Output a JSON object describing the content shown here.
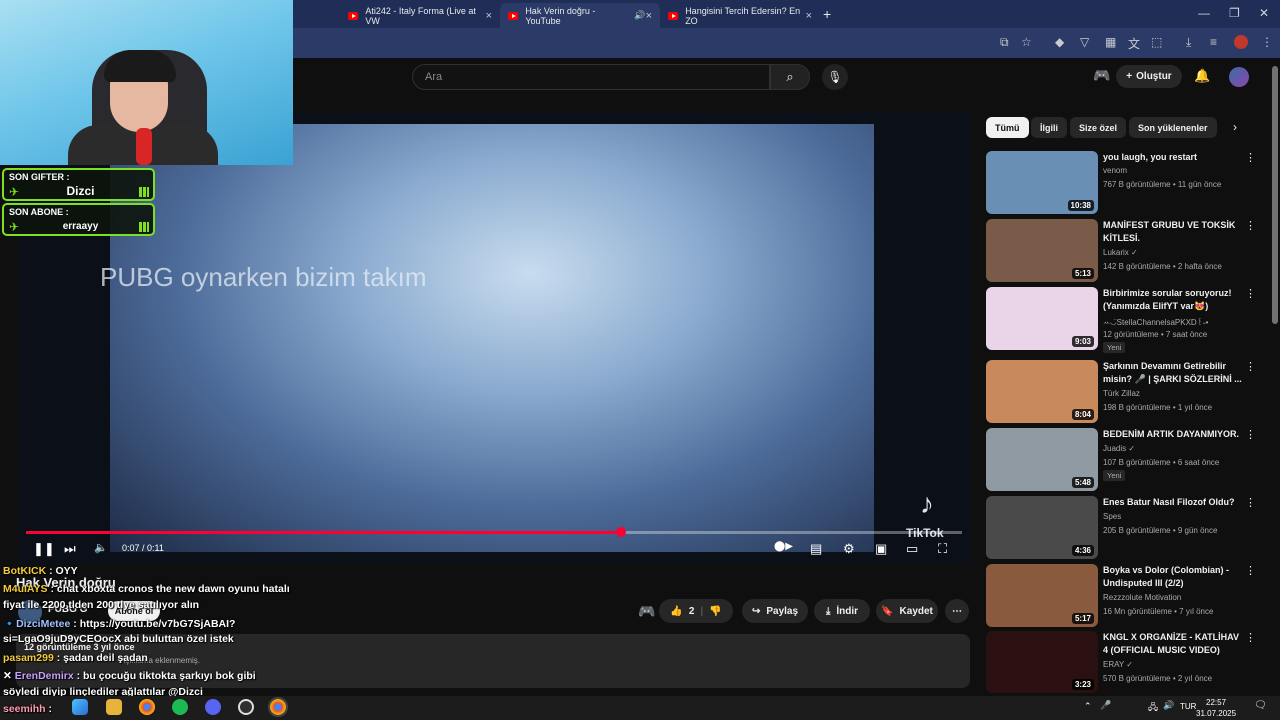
{
  "browser": {
    "tabs": [
      {
        "label": "Ati242 - Italy Forma (Live at VW",
        "active": false
      },
      {
        "label": "Hak Verin doğru - YouTube",
        "active": true
      },
      {
        "label": "Hangisini Tercih Edersin? En ZO",
        "active": false
      }
    ],
    "new_tab": "+",
    "close": "×"
  },
  "stream": {
    "gifter_label": "SON GIFTER :",
    "gifter_name": "Dizci",
    "sub_label": "SON ABONE :",
    "sub_name": "erraayy"
  },
  "youtube": {
    "search_placeholder": "Ara",
    "create_label": "Oluştur",
    "video_overlay_text": "PUBG oynarken bizim takım",
    "watermark": "TikTok",
    "progress": 0.636,
    "time": "0:07 / 0:11",
    "video_title": "Hak Verin doğru",
    "channel": "PUBG G",
    "subscribe": "Abone ol",
    "like_count": "2",
    "share": "Paylaş",
    "download": "İndir",
    "save": "Kaydet",
    "desc_views": "12 görüntüleme  3 yıl önce",
    "desc_more": "Açıklama eklenmemiş."
  },
  "chat": [
    {
      "user": "BotKICK",
      "text": ": OYY"
    },
    {
      "user": "M4uIAYS",
      "text": ": chat xboxta cronos the new dawn oyunu hatalı"
    },
    {
      "user": "",
      "text": "fiyat ile 2200 tlden 200 tlye satılıyor alın"
    },
    {
      "user": "DizciMetee",
      "text": ": https://youtu.be/v7bG7SjABAI?"
    },
    {
      "user": "",
      "text": "si=LgaO9juD9yCEOocX abi buluttan özel istek"
    },
    {
      "user": "pasam299",
      "text": ": şadan deil şadan"
    },
    {
      "user": "ErenDemirx",
      "text": ": bu çocuğu tiktokta şarkıyı bok gibi"
    },
    {
      "user": "",
      "text": "söyledi diyip linçlediler ağlattılar @Dizci"
    },
    {
      "user": "seemihh",
      "text": ":"
    }
  ],
  "chips": [
    "Tümü",
    "İlgili",
    "Size özel",
    "Son yüklenenler"
  ],
  "recommendations": [
    {
      "title": "you laugh, you restart",
      "channel": "venom",
      "meta": "767 B görüntüleme • 11 gün önce",
      "duration": "10:38",
      "new": "",
      "color": "#6a8fb5"
    },
    {
      "title": "MANİFEST GRUBU VE TOKSİK KİTLESİ.",
      "channel": "Lukarix ✓",
      "meta": "142 B görüntüleme • 2 hafta önce",
      "duration": "5:13",
      "new": "",
      "color": "#7a5a48"
    },
    {
      "title": "Birbirimize sorular soruyoruz! (Yanımızda ElifYT var😻)",
      "channel": "ꕀ◡̈StellaChannelsaPKXD꒰˶•",
      "meta": "12 görüntüleme • 7 saat önce",
      "duration": "9:03",
      "new": "Yeni",
      "color": "#e9d4e8"
    },
    {
      "title": "Şarkının Devamını Getirebilir misin? 🎤 | ŞARKI SÖZLERİNİ ...",
      "channel": "Türk Zillaz",
      "meta": "198 B görüntüleme • 1 yıl önce",
      "duration": "8:04",
      "new": "",
      "color": "#c88a5c"
    },
    {
      "title": "BEDENİM ARTIK DAYANMIYOR.",
      "channel": "Juadis ✓",
      "meta": "107 B görüntüleme • 6 saat önce",
      "duration": "5:48",
      "new": "Yeni",
      "color": "#8f9aa3"
    },
    {
      "title": "Enes Batur Nasıl Filozof Oldu?",
      "channel": "Spes",
      "meta": "205 B görüntüleme • 9 gün önce",
      "duration": "4:36",
      "new": "",
      "color": "#4a4a4a"
    },
    {
      "title": "Boyka vs Dolor (Colombian) - Undisputed III (2/2)",
      "channel": "Rezzzolute Motivation",
      "meta": "16 Mn görüntüleme • 7 yıl önce",
      "duration": "5:17",
      "new": "",
      "color": "#8a5a3e"
    },
    {
      "title": "KNGL X ORGANİZE - KATLİHAV 4 (OFFICIAL MUSIC VIDEO)",
      "channel": "ERAY ✓",
      "meta": "570 B görüntüleme • 2 yıl önce",
      "duration": "3:23",
      "new": "",
      "color": "#2a1010"
    }
  ],
  "taskbar": {
    "lang": "TUR",
    "time": "22:57",
    "date": "31.07.2025"
  }
}
